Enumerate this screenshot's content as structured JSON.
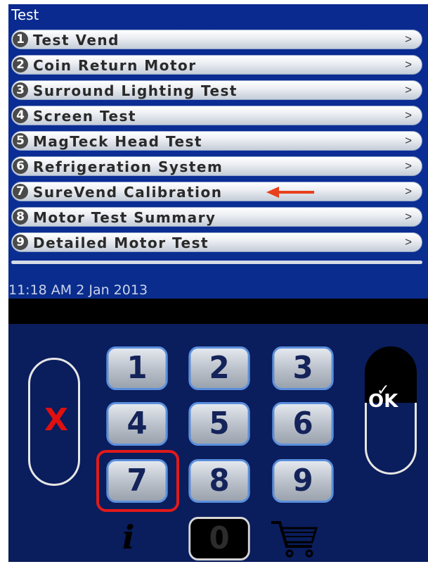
{
  "screen": {
    "title": "Test",
    "clock": "11:18 AM 2 Jan 2013"
  },
  "menu": {
    "items": [
      {
        "num": "1",
        "label": "Test Vend",
        "chevron": ">"
      },
      {
        "num": "2",
        "label": "Coin Return Motor",
        "chevron": ">"
      },
      {
        "num": "3",
        "label": "Surround Lighting Test",
        "chevron": ">"
      },
      {
        "num": "4",
        "label": "Screen Test",
        "chevron": ">"
      },
      {
        "num": "5",
        "label": "MagTeck Head Test",
        "chevron": ">"
      },
      {
        "num": "6",
        "label": "Refrigeration System",
        "chevron": ">"
      },
      {
        "num": "7",
        "label": "SureVend Calibration",
        "chevron": ">"
      },
      {
        "num": "8",
        "label": "Motor Test Summary",
        "chevron": ">"
      },
      {
        "num": "9",
        "label": "Detailed Motor Test",
        "chevron": ">"
      }
    ]
  },
  "keypad": {
    "cancel_label": "X",
    "ok_label": "OK",
    "keys": [
      "1",
      "2",
      "3",
      "4",
      "5",
      "6",
      "7",
      "8",
      "9",
      "0"
    ],
    "highlighted_key": "7",
    "info_icon": "info-icon",
    "cart_icon": "shopping-cart-icon"
  },
  "colors": {
    "screen_bg": "#0b2e96",
    "highlight": "#e11a1a",
    "key_border": "#5b8fdd",
    "keypad_bg": "#0a1d5c"
  }
}
